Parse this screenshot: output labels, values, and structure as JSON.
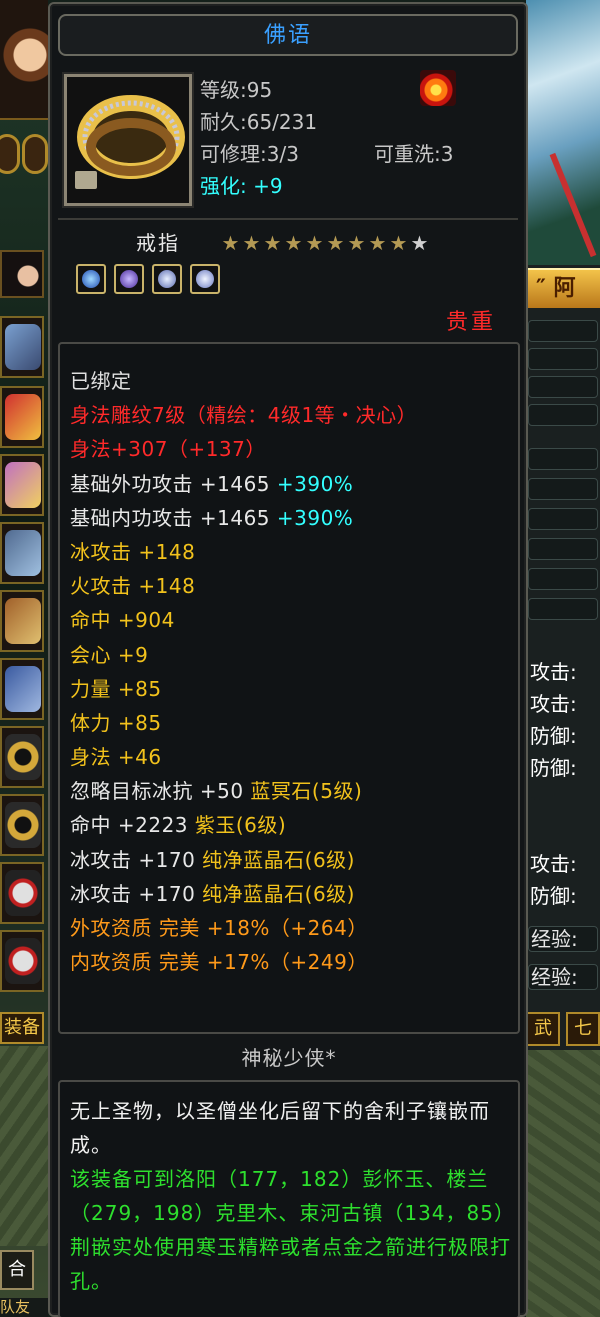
{
  "tooltip": {
    "title": "佛语",
    "level": "等级:95",
    "durability": "耐久:65/231",
    "repairable": "可修理:3/3",
    "rewashable": "可重洗:3",
    "enhance_label": "强化:",
    "enhance_value": "+9",
    "item_type": "戒指",
    "stars_filled": 9,
    "stars_total": 10,
    "star_glyph": "★",
    "gem_count": 4,
    "rarity": "贵重",
    "attribute_lines": [
      [
        {
          "t": "已绑定",
          "c": "#e0e0e0"
        }
      ],
      [
        {
          "t": "身法雕纹7级（精绘：4级1等・决心）",
          "c": "#ff2a2a"
        }
      ],
      [
        {
          "t": "身法+307（+137）",
          "c": "#ff2a2a"
        }
      ],
      [
        {
          "t": "基础外功攻击 +1465 ",
          "c": "#e8e8e8"
        },
        {
          "t": "+390%",
          "c": "#33ffff"
        }
      ],
      [
        {
          "t": "基础内功攻击 +1465 ",
          "c": "#e8e8e8"
        },
        {
          "t": "+390%",
          "c": "#33ffff"
        }
      ],
      [
        {
          "t": "冰攻击 +148",
          "c": "#f2c21c"
        }
      ],
      [
        {
          "t": "火攻击 +148",
          "c": "#f2c21c"
        }
      ],
      [
        {
          "t": "命中 +904",
          "c": "#f2c21c"
        }
      ],
      [
        {
          "t": "会心 +9",
          "c": "#f2c21c"
        }
      ],
      [
        {
          "t": "力量 +85",
          "c": "#f2c21c"
        }
      ],
      [
        {
          "t": "体力 +85",
          "c": "#f2c21c"
        }
      ],
      [
        {
          "t": "身法 +46",
          "c": "#f2c21c"
        }
      ],
      [
        {
          "t": "忽略目标冰抗 +50 ",
          "c": "#e8e8e8"
        },
        {
          "t": "蓝冥石(5级)",
          "c": "#f2c21c"
        }
      ],
      [
        {
          "t": "命中 +2223 ",
          "c": "#e8e8e8"
        },
        {
          "t": "紫玉(6级)",
          "c": "#f2c21c"
        }
      ],
      [
        {
          "t": "冰攻击 +170 ",
          "c": "#e8e8e8"
        },
        {
          "t": "纯净蓝晶石(6级)",
          "c": "#f2c21c"
        }
      ],
      [
        {
          "t": "冰攻击 +170 ",
          "c": "#e8e8e8"
        },
        {
          "t": "纯净蓝晶石(6级)",
          "c": "#f2c21c"
        }
      ],
      [
        {
          "t": "外攻资质 完美 +18%（+264）",
          "c": "#ff9a1a"
        }
      ],
      [
        {
          "t": "内攻资质 完美 +17%（+249）",
          "c": "#ff9a1a"
        }
      ]
    ],
    "owner": "神秘少侠*",
    "description": "无上圣物，以圣僧坐化后留下的舍利子镶嵌而成。",
    "location_hint": "该装备可到洛阳（177，182）彭怀玉、楼兰（279，198）克里木、束河古镇（134，85）荆嵌实处使用寒玉精粹或者点金之箭进行极限打孔。"
  },
  "left_panel": {
    "equip_tab": "装备",
    "combine_tab": "合",
    "friend_tab": "队友"
  },
  "right_panel": {
    "header": "″ 阿",
    "labels": [
      "攻击:",
      "攻击:",
      "防御:",
      "防御:",
      "攻击:",
      "防御:"
    ],
    "exp_rows": [
      "经验:",
      "经验:"
    ],
    "tab_martial": "武",
    "tab_seven": "七"
  }
}
